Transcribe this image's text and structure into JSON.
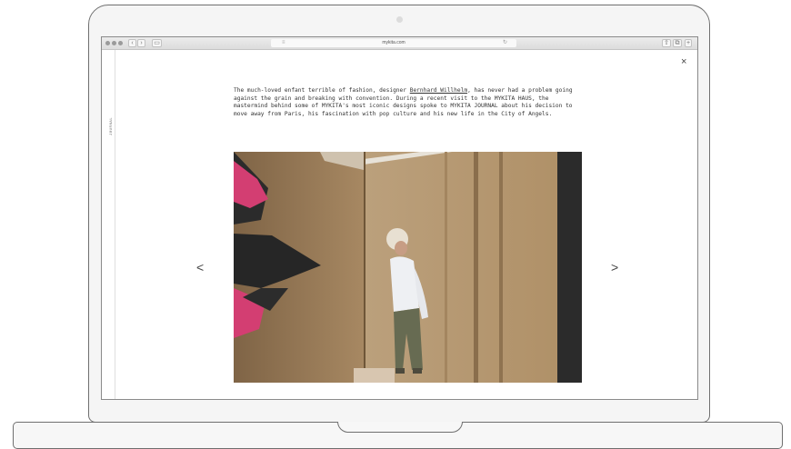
{
  "browser": {
    "url": "mykita.com"
  },
  "page": {
    "side_label": "JOURNAL",
    "intro": {
      "before_link": "The much-loved enfant terrible of fashion, designer ",
      "link": "Bernhard Willhelm",
      "after_link": ", has never had a problem going against the grain and breaking with convention. During a recent visit to the MYKITA HAUS, the mastermind behind some of MYKITA's most iconic designs spoke to MYKITA JOURNAL about his decision to move away from Paris, his fascination with pop culture and his new life in the City of Angels."
    },
    "close_symbol": "×",
    "prev_symbol": "<",
    "next_symbol": ">"
  },
  "colors": {
    "wall": "#b0916a",
    "board_dark": "#2b2b2b",
    "mural_pink": "#d33e72"
  },
  "icons": [
    "close-icon",
    "prev-arrow-icon",
    "next-arrow-icon",
    "share-icon",
    "tabs-icon",
    "sidebar-icon"
  ]
}
